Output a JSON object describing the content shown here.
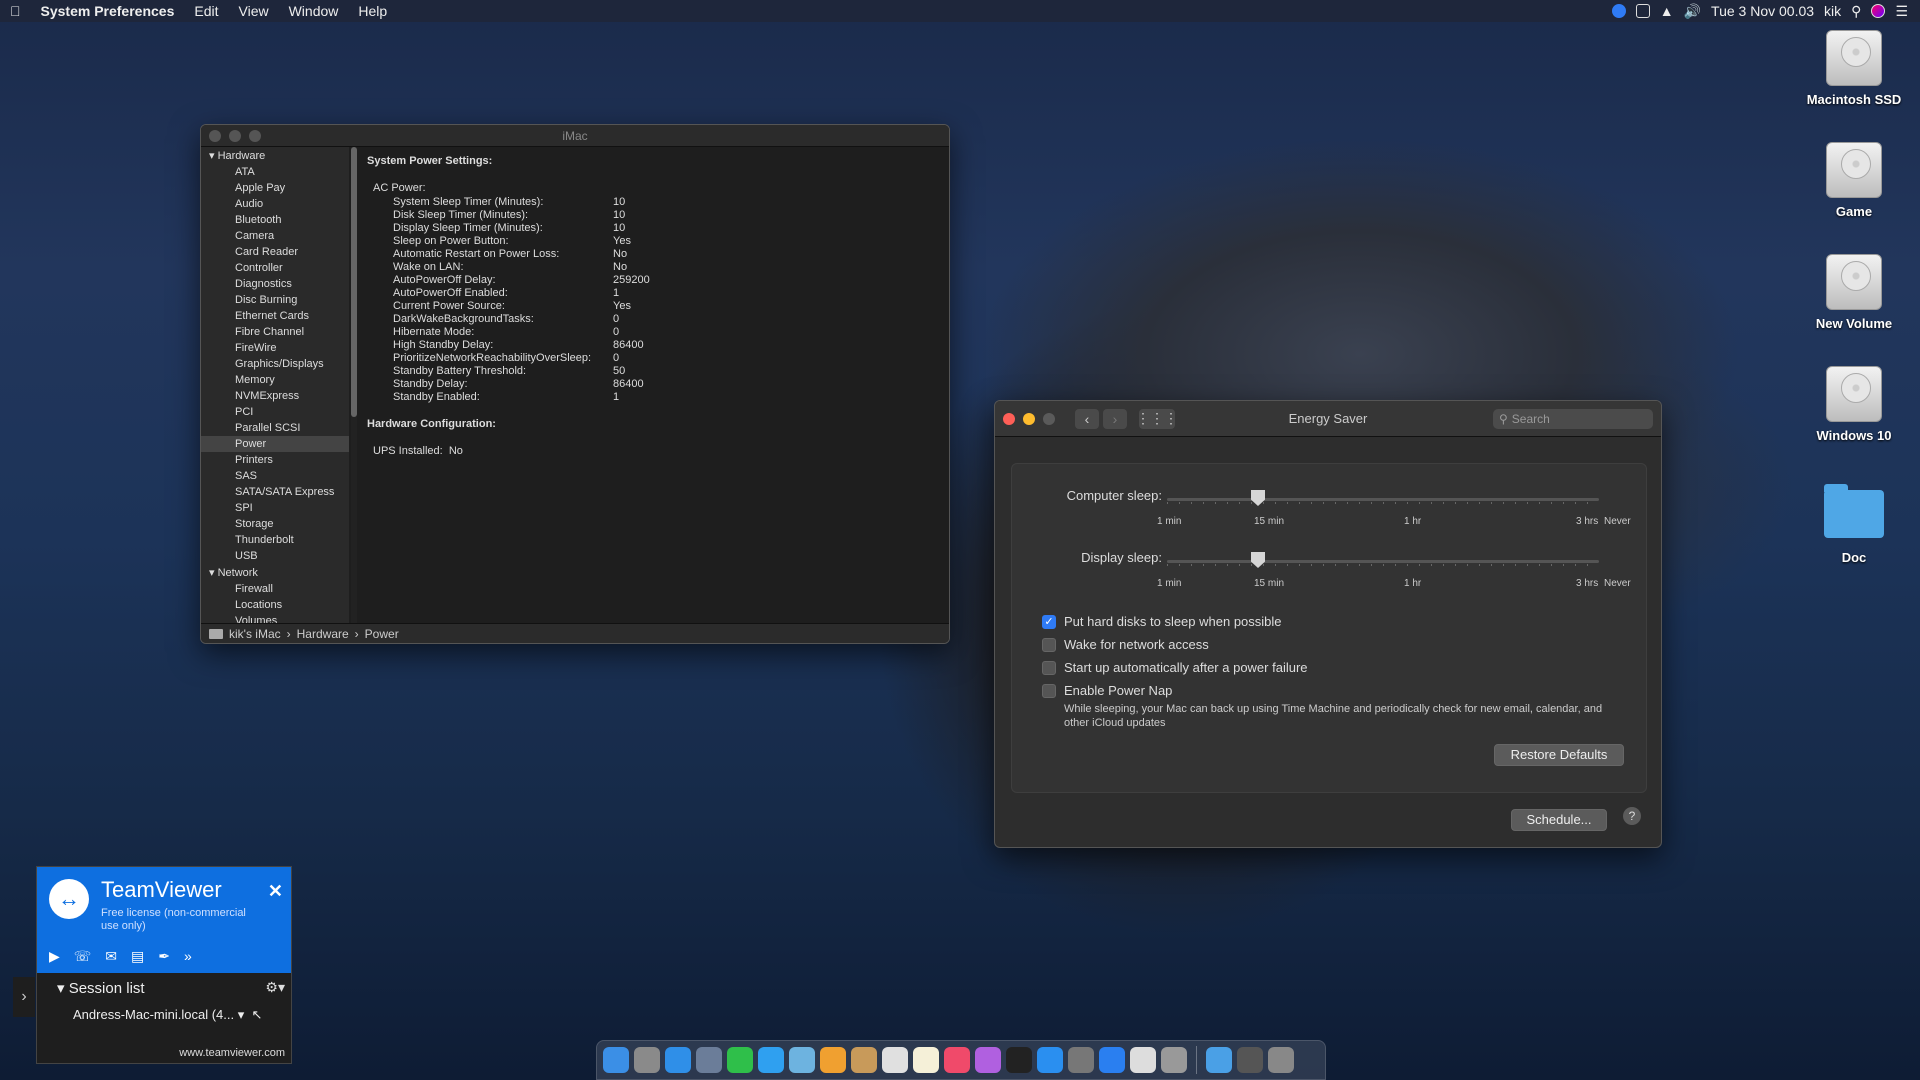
{
  "menubar": {
    "app": "System Preferences",
    "menus": [
      "Edit",
      "View",
      "Window",
      "Help"
    ],
    "datetime": "Tue 3 Nov  00.03",
    "user": "kik"
  },
  "desktop_icons": [
    {
      "label": "Macintosh SSD"
    },
    {
      "label": "Game"
    },
    {
      "label": "New Volume"
    },
    {
      "label": "Windows 10"
    },
    {
      "label": "Doc"
    }
  ],
  "sysinfo": {
    "title": "iMac",
    "sidebar": {
      "hardware": "Hardware",
      "hardware_items": [
        "ATA",
        "Apple Pay",
        "Audio",
        "Bluetooth",
        "Camera",
        "Card Reader",
        "Controller",
        "Diagnostics",
        "Disc Burning",
        "Ethernet Cards",
        "Fibre Channel",
        "FireWire",
        "Graphics/Displays",
        "Memory",
        "NVMExpress",
        "PCI",
        "Parallel SCSI",
        "Power",
        "Printers",
        "SAS",
        "SATA/SATA Express",
        "SPI",
        "Storage",
        "Thunderbolt",
        "USB"
      ],
      "network": "Network",
      "network_items": [
        "Firewall",
        "Locations",
        "Volumes"
      ],
      "selected": "Power"
    },
    "main": {
      "power_heading": "System Power Settings:",
      "ac_power": "AC Power:",
      "rows": [
        {
          "k": "System Sleep Timer (Minutes):",
          "v": "10"
        },
        {
          "k": "Disk Sleep Timer (Minutes):",
          "v": "10"
        },
        {
          "k": "Display Sleep Timer (Minutes):",
          "v": "10"
        },
        {
          "k": "Sleep on Power Button:",
          "v": "Yes"
        },
        {
          "k": "Automatic Restart on Power Loss:",
          "v": "No"
        },
        {
          "k": "Wake on LAN:",
          "v": "No"
        },
        {
          "k": "AutoPowerOff Delay:",
          "v": "259200"
        },
        {
          "k": "AutoPowerOff Enabled:",
          "v": "1"
        },
        {
          "k": "Current Power Source:",
          "v": "Yes"
        },
        {
          "k": "DarkWakeBackgroundTasks:",
          "v": "0"
        },
        {
          "k": "Hibernate Mode:",
          "v": "0"
        },
        {
          "k": "High Standby Delay:",
          "v": "86400"
        },
        {
          "k": "PrioritizeNetworkReachabilityOverSleep:",
          "v": "0"
        },
        {
          "k": "Standby Battery Threshold:",
          "v": "50"
        },
        {
          "k": "Standby Delay:",
          "v": "86400"
        },
        {
          "k": "Standby Enabled:",
          "v": "1"
        }
      ],
      "hw_heading": "Hardware Configuration:",
      "ups_label": "UPS Installed:",
      "ups_value": "No"
    },
    "breadcrumb": [
      "kik's iMac",
      "Hardware",
      "Power"
    ]
  },
  "energy": {
    "title": "Energy Saver",
    "search_placeholder": "Search",
    "computer_sleep_label": "Computer sleep:",
    "display_sleep_label": "Display sleep:",
    "ticks": [
      "1 min",
      "15 min",
      "1 hr",
      "3 hrs",
      "Never"
    ],
    "computer_sleep_value": "15 min",
    "display_sleep_value": "15 min",
    "checkboxes": [
      {
        "label": "Put hard disks to sleep when possible",
        "checked": true
      },
      {
        "label": "Wake for network access",
        "checked": false
      },
      {
        "label": "Start up automatically after a power failure",
        "checked": false
      },
      {
        "label": "Enable Power Nap",
        "checked": false
      }
    ],
    "power_nap_note": "While sleeping, your Mac can back up using Time Machine and periodically check for new email, calendar, and other iCloud updates",
    "restore_defaults": "Restore Defaults",
    "schedule": "Schedule...",
    "help": "?"
  },
  "teamviewer": {
    "title": "TeamViewer",
    "license": "Free license (non-commercial use only)",
    "session_list": "Session list",
    "device": "Andress-Mac-mini.local (4...",
    "url": "www.teamviewer.com"
  },
  "dock": {
    "colors": [
      "#3b8fe6",
      "#8a8a8a",
      "#2f8fe8",
      "#6b7d99",
      "#2fbf4a",
      "#2fa0f0",
      "#6db3e0",
      "#f0a030",
      "#c89a5a",
      "#e0e0e0",
      "#f5f0d8",
      "#f04a6a",
      "#b060e0",
      "#222222",
      "#2a8ff0",
      "#777777",
      "#2a7ff0",
      "#dddddd",
      "#999999",
      "#4aa0e6",
      "#555555",
      "#888888"
    ]
  }
}
